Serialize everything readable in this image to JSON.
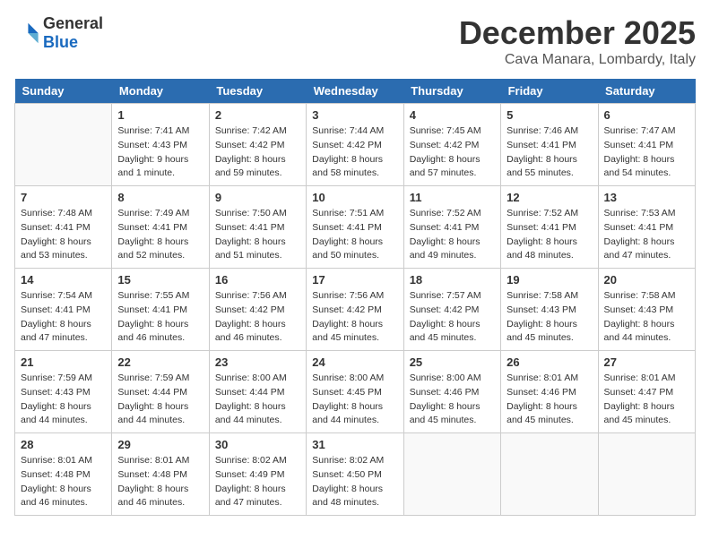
{
  "header": {
    "logo_general": "General",
    "logo_blue": "Blue",
    "month": "December 2025",
    "location": "Cava Manara, Lombardy, Italy"
  },
  "weekdays": [
    "Sunday",
    "Monday",
    "Tuesday",
    "Wednesday",
    "Thursday",
    "Friday",
    "Saturday"
  ],
  "weeks": [
    [
      {
        "day": "",
        "info": ""
      },
      {
        "day": "1",
        "info": "Sunrise: 7:41 AM\nSunset: 4:43 PM\nDaylight: 9 hours\nand 1 minute."
      },
      {
        "day": "2",
        "info": "Sunrise: 7:42 AM\nSunset: 4:42 PM\nDaylight: 8 hours\nand 59 minutes."
      },
      {
        "day": "3",
        "info": "Sunrise: 7:44 AM\nSunset: 4:42 PM\nDaylight: 8 hours\nand 58 minutes."
      },
      {
        "day": "4",
        "info": "Sunrise: 7:45 AM\nSunset: 4:42 PM\nDaylight: 8 hours\nand 57 minutes."
      },
      {
        "day": "5",
        "info": "Sunrise: 7:46 AM\nSunset: 4:41 PM\nDaylight: 8 hours\nand 55 minutes."
      },
      {
        "day": "6",
        "info": "Sunrise: 7:47 AM\nSunset: 4:41 PM\nDaylight: 8 hours\nand 54 minutes."
      }
    ],
    [
      {
        "day": "7",
        "info": "Sunrise: 7:48 AM\nSunset: 4:41 PM\nDaylight: 8 hours\nand 53 minutes."
      },
      {
        "day": "8",
        "info": "Sunrise: 7:49 AM\nSunset: 4:41 PM\nDaylight: 8 hours\nand 52 minutes."
      },
      {
        "day": "9",
        "info": "Sunrise: 7:50 AM\nSunset: 4:41 PM\nDaylight: 8 hours\nand 51 minutes."
      },
      {
        "day": "10",
        "info": "Sunrise: 7:51 AM\nSunset: 4:41 PM\nDaylight: 8 hours\nand 50 minutes."
      },
      {
        "day": "11",
        "info": "Sunrise: 7:52 AM\nSunset: 4:41 PM\nDaylight: 8 hours\nand 49 minutes."
      },
      {
        "day": "12",
        "info": "Sunrise: 7:52 AM\nSunset: 4:41 PM\nDaylight: 8 hours\nand 48 minutes."
      },
      {
        "day": "13",
        "info": "Sunrise: 7:53 AM\nSunset: 4:41 PM\nDaylight: 8 hours\nand 47 minutes."
      }
    ],
    [
      {
        "day": "14",
        "info": "Sunrise: 7:54 AM\nSunset: 4:41 PM\nDaylight: 8 hours\nand 47 minutes."
      },
      {
        "day": "15",
        "info": "Sunrise: 7:55 AM\nSunset: 4:41 PM\nDaylight: 8 hours\nand 46 minutes."
      },
      {
        "day": "16",
        "info": "Sunrise: 7:56 AM\nSunset: 4:42 PM\nDaylight: 8 hours\nand 46 minutes."
      },
      {
        "day": "17",
        "info": "Sunrise: 7:56 AM\nSunset: 4:42 PM\nDaylight: 8 hours\nand 45 minutes."
      },
      {
        "day": "18",
        "info": "Sunrise: 7:57 AM\nSunset: 4:42 PM\nDaylight: 8 hours\nand 45 minutes."
      },
      {
        "day": "19",
        "info": "Sunrise: 7:58 AM\nSunset: 4:43 PM\nDaylight: 8 hours\nand 45 minutes."
      },
      {
        "day": "20",
        "info": "Sunrise: 7:58 AM\nSunset: 4:43 PM\nDaylight: 8 hours\nand 44 minutes."
      }
    ],
    [
      {
        "day": "21",
        "info": "Sunrise: 7:59 AM\nSunset: 4:43 PM\nDaylight: 8 hours\nand 44 minutes."
      },
      {
        "day": "22",
        "info": "Sunrise: 7:59 AM\nSunset: 4:44 PM\nDaylight: 8 hours\nand 44 minutes."
      },
      {
        "day": "23",
        "info": "Sunrise: 8:00 AM\nSunset: 4:44 PM\nDaylight: 8 hours\nand 44 minutes."
      },
      {
        "day": "24",
        "info": "Sunrise: 8:00 AM\nSunset: 4:45 PM\nDaylight: 8 hours\nand 44 minutes."
      },
      {
        "day": "25",
        "info": "Sunrise: 8:00 AM\nSunset: 4:46 PM\nDaylight: 8 hours\nand 45 minutes."
      },
      {
        "day": "26",
        "info": "Sunrise: 8:01 AM\nSunset: 4:46 PM\nDaylight: 8 hours\nand 45 minutes."
      },
      {
        "day": "27",
        "info": "Sunrise: 8:01 AM\nSunset: 4:47 PM\nDaylight: 8 hours\nand 45 minutes."
      }
    ],
    [
      {
        "day": "28",
        "info": "Sunrise: 8:01 AM\nSunset: 4:48 PM\nDaylight: 8 hours\nand 46 minutes."
      },
      {
        "day": "29",
        "info": "Sunrise: 8:01 AM\nSunset: 4:48 PM\nDaylight: 8 hours\nand 46 minutes."
      },
      {
        "day": "30",
        "info": "Sunrise: 8:02 AM\nSunset: 4:49 PM\nDaylight: 8 hours\nand 47 minutes."
      },
      {
        "day": "31",
        "info": "Sunrise: 8:02 AM\nSunset: 4:50 PM\nDaylight: 8 hours\nand 48 minutes."
      },
      {
        "day": "",
        "info": ""
      },
      {
        "day": "",
        "info": ""
      },
      {
        "day": "",
        "info": ""
      }
    ]
  ]
}
